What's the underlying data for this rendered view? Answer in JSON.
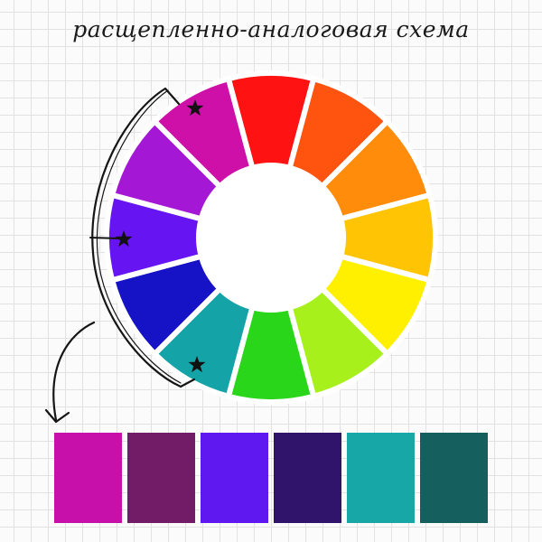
{
  "title": "расщепленно-аналоговая схема",
  "wheel": {
    "segments": [
      {
        "name": "red",
        "color": "#ff1212"
      },
      {
        "name": "red-orange",
        "color": "#ff5410"
      },
      {
        "name": "orange",
        "color": "#ff8c0a"
      },
      {
        "name": "yellow-orange",
        "color": "#ffc404"
      },
      {
        "name": "yellow",
        "color": "#fff000"
      },
      {
        "name": "yellow-green",
        "color": "#a8f01c"
      },
      {
        "name": "green",
        "color": "#2ad61a"
      },
      {
        "name": "teal",
        "color": "#14a3a6"
      },
      {
        "name": "blue",
        "color": "#1612c6"
      },
      {
        "name": "violet",
        "color": "#6714f2"
      },
      {
        "name": "purple",
        "color": "#a417d5"
      },
      {
        "name": "magenta",
        "color": "#ce0fa8"
      }
    ],
    "starred": [
      "magenta",
      "violet",
      "teal"
    ]
  },
  "swatches": [
    {
      "name": "magenta",
      "color": "#c70fa9"
    },
    {
      "name": "dark-magenta",
      "color": "#721c68"
    },
    {
      "name": "violet",
      "color": "#5f19f0"
    },
    {
      "name": "dark-violet",
      "color": "#30136b"
    },
    {
      "name": "teal",
      "color": "#17a7a6"
    },
    {
      "name": "dark-teal",
      "color": "#15605e"
    }
  ]
}
